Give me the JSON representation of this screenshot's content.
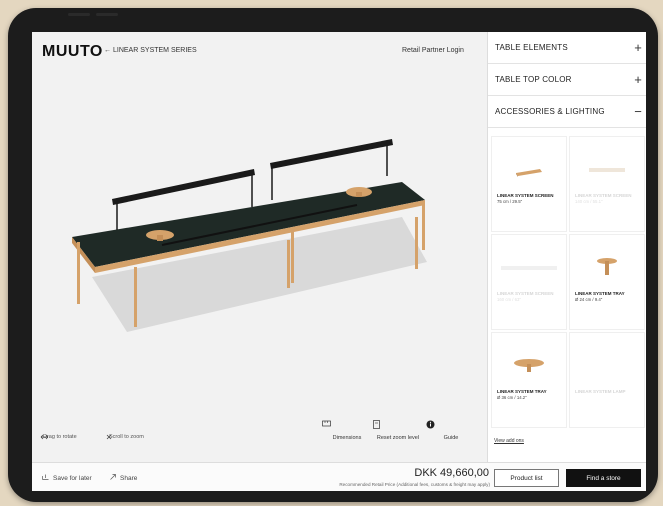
{
  "header": {
    "logo": "MUUTO",
    "back_link": "LINEAR SYSTEM SERIES",
    "retailer_login": "Retail Partner Login"
  },
  "viewer": {
    "hints": [
      {
        "label": "Drag to rotate",
        "icon": "drag-rotate-icon"
      },
      {
        "label": "Scroll to zoom",
        "icon": "zoom-icon"
      }
    ],
    "tools": [
      {
        "label": "Dimensions",
        "icon": "ruler-icon"
      },
      {
        "label": "Reset zoom level",
        "icon": "reset-icon"
      },
      {
        "label": "Guide",
        "icon": "info-icon"
      }
    ],
    "colors": {
      "tabletop": "#1f2a26",
      "wood": "#d5a26a",
      "screen_bar": "#1a1a1a"
    }
  },
  "panel": {
    "sections": [
      {
        "title": "TABLE ELEMENTS",
        "sign": "+"
      },
      {
        "title": "TABLE TOP COLOR",
        "sign": "+"
      },
      {
        "title": "ACCESSORIES & LIGHTING",
        "sign": "−"
      }
    ],
    "accessories": [
      {
        "name": "LINEAR SYSTEM SCREEN",
        "size": "75 cm / 29.5\"",
        "faded": false,
        "icon": "screen-product-icon"
      },
      {
        "name": "LINEAR SYSTEM SCREEN",
        "size": "140 cm / 55.1\"",
        "faded": true,
        "icon": "screen-product-icon"
      },
      {
        "name": "LINEAR SYSTEM SCREEN",
        "size": "160 cm / 63\"",
        "faded": true,
        "icon": "screen-product-icon"
      },
      {
        "name": "LINEAR SYSTEM TRAY",
        "size": "Ø 24 cm / 9.4\"",
        "faded": false,
        "icon": "tray-product-icon"
      },
      {
        "name": "LINEAR SYSTEM TRAY",
        "size": "Ø 36 cm / 14.2\"",
        "faded": false,
        "icon": "tray-product-icon"
      },
      {
        "name": "LINEAR SYSTEM LAMP",
        "size": "",
        "faded": true,
        "icon": "lamp-product-icon"
      }
    ],
    "view_add_link": "View add ons"
  },
  "bottombar": {
    "save_label": "Save for later",
    "share_label": "Share",
    "price": "DKK 49,660,00",
    "price_note": "Recommended Retail Price (Additional fees, customs & freight may apply)",
    "product_list_label": "Product list",
    "find_store_label": "Find a store"
  }
}
